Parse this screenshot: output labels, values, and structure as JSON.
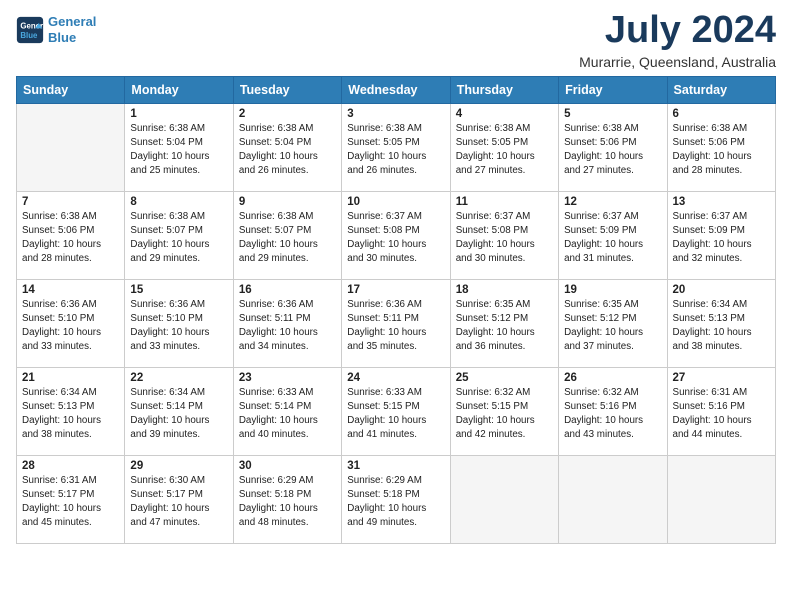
{
  "header": {
    "logo_line1": "General",
    "logo_line2": "Blue",
    "month_title": "July 2024",
    "location": "Murarrie, Queensland, Australia"
  },
  "weekdays": [
    "Sunday",
    "Monday",
    "Tuesday",
    "Wednesday",
    "Thursday",
    "Friday",
    "Saturday"
  ],
  "weeks": [
    [
      {
        "day": "",
        "info": ""
      },
      {
        "day": "1",
        "info": "Sunrise: 6:38 AM\nSunset: 5:04 PM\nDaylight: 10 hours\nand 25 minutes."
      },
      {
        "day": "2",
        "info": "Sunrise: 6:38 AM\nSunset: 5:04 PM\nDaylight: 10 hours\nand 26 minutes."
      },
      {
        "day": "3",
        "info": "Sunrise: 6:38 AM\nSunset: 5:05 PM\nDaylight: 10 hours\nand 26 minutes."
      },
      {
        "day": "4",
        "info": "Sunrise: 6:38 AM\nSunset: 5:05 PM\nDaylight: 10 hours\nand 27 minutes."
      },
      {
        "day": "5",
        "info": "Sunrise: 6:38 AM\nSunset: 5:06 PM\nDaylight: 10 hours\nand 27 minutes."
      },
      {
        "day": "6",
        "info": "Sunrise: 6:38 AM\nSunset: 5:06 PM\nDaylight: 10 hours\nand 28 minutes."
      }
    ],
    [
      {
        "day": "7",
        "info": "Sunrise: 6:38 AM\nSunset: 5:06 PM\nDaylight: 10 hours\nand 28 minutes."
      },
      {
        "day": "8",
        "info": "Sunrise: 6:38 AM\nSunset: 5:07 PM\nDaylight: 10 hours\nand 29 minutes."
      },
      {
        "day": "9",
        "info": "Sunrise: 6:38 AM\nSunset: 5:07 PM\nDaylight: 10 hours\nand 29 minutes."
      },
      {
        "day": "10",
        "info": "Sunrise: 6:37 AM\nSunset: 5:08 PM\nDaylight: 10 hours\nand 30 minutes."
      },
      {
        "day": "11",
        "info": "Sunrise: 6:37 AM\nSunset: 5:08 PM\nDaylight: 10 hours\nand 30 minutes."
      },
      {
        "day": "12",
        "info": "Sunrise: 6:37 AM\nSunset: 5:09 PM\nDaylight: 10 hours\nand 31 minutes."
      },
      {
        "day": "13",
        "info": "Sunrise: 6:37 AM\nSunset: 5:09 PM\nDaylight: 10 hours\nand 32 minutes."
      }
    ],
    [
      {
        "day": "14",
        "info": "Sunrise: 6:36 AM\nSunset: 5:10 PM\nDaylight: 10 hours\nand 33 minutes."
      },
      {
        "day": "15",
        "info": "Sunrise: 6:36 AM\nSunset: 5:10 PM\nDaylight: 10 hours\nand 33 minutes."
      },
      {
        "day": "16",
        "info": "Sunrise: 6:36 AM\nSunset: 5:11 PM\nDaylight: 10 hours\nand 34 minutes."
      },
      {
        "day": "17",
        "info": "Sunrise: 6:36 AM\nSunset: 5:11 PM\nDaylight: 10 hours\nand 35 minutes."
      },
      {
        "day": "18",
        "info": "Sunrise: 6:35 AM\nSunset: 5:12 PM\nDaylight: 10 hours\nand 36 minutes."
      },
      {
        "day": "19",
        "info": "Sunrise: 6:35 AM\nSunset: 5:12 PM\nDaylight: 10 hours\nand 37 minutes."
      },
      {
        "day": "20",
        "info": "Sunrise: 6:34 AM\nSunset: 5:13 PM\nDaylight: 10 hours\nand 38 minutes."
      }
    ],
    [
      {
        "day": "21",
        "info": "Sunrise: 6:34 AM\nSunset: 5:13 PM\nDaylight: 10 hours\nand 38 minutes."
      },
      {
        "day": "22",
        "info": "Sunrise: 6:34 AM\nSunset: 5:14 PM\nDaylight: 10 hours\nand 39 minutes."
      },
      {
        "day": "23",
        "info": "Sunrise: 6:33 AM\nSunset: 5:14 PM\nDaylight: 10 hours\nand 40 minutes."
      },
      {
        "day": "24",
        "info": "Sunrise: 6:33 AM\nSunset: 5:15 PM\nDaylight: 10 hours\nand 41 minutes."
      },
      {
        "day": "25",
        "info": "Sunrise: 6:32 AM\nSunset: 5:15 PM\nDaylight: 10 hours\nand 42 minutes."
      },
      {
        "day": "26",
        "info": "Sunrise: 6:32 AM\nSunset: 5:16 PM\nDaylight: 10 hours\nand 43 minutes."
      },
      {
        "day": "27",
        "info": "Sunrise: 6:31 AM\nSunset: 5:16 PM\nDaylight: 10 hours\nand 44 minutes."
      }
    ],
    [
      {
        "day": "28",
        "info": "Sunrise: 6:31 AM\nSunset: 5:17 PM\nDaylight: 10 hours\nand 45 minutes."
      },
      {
        "day": "29",
        "info": "Sunrise: 6:30 AM\nSunset: 5:17 PM\nDaylight: 10 hours\nand 47 minutes."
      },
      {
        "day": "30",
        "info": "Sunrise: 6:29 AM\nSunset: 5:18 PM\nDaylight: 10 hours\nand 48 minutes."
      },
      {
        "day": "31",
        "info": "Sunrise: 6:29 AM\nSunset: 5:18 PM\nDaylight: 10 hours\nand 49 minutes."
      },
      {
        "day": "",
        "info": ""
      },
      {
        "day": "",
        "info": ""
      },
      {
        "day": "",
        "info": ""
      }
    ]
  ]
}
